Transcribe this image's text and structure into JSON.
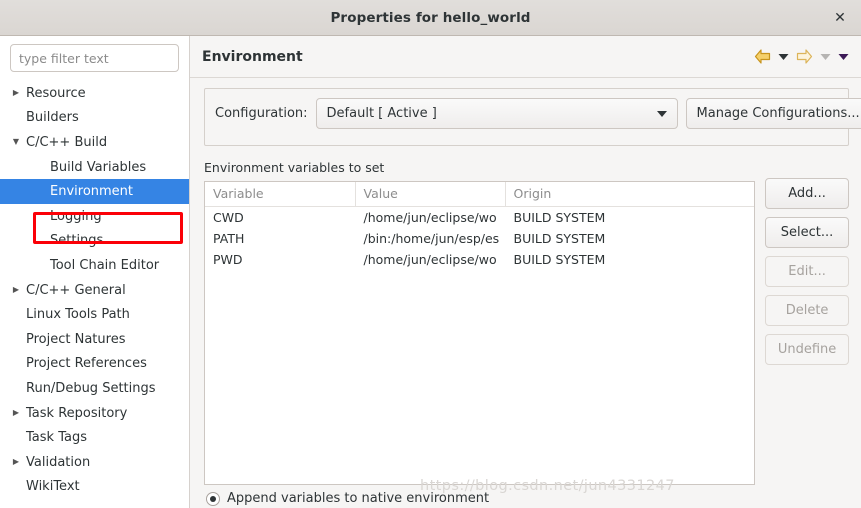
{
  "window": {
    "title": "Properties for hello_world",
    "close_label": "✕"
  },
  "sidebar": {
    "filter_placeholder": "type filter text",
    "filter_value": "",
    "items": [
      {
        "label": "Resource",
        "twisty": "collapsed",
        "indent": 0,
        "selected": false
      },
      {
        "label": "Builders",
        "twisty": "none",
        "indent": 0,
        "selected": false
      },
      {
        "label": "C/C++ Build",
        "twisty": "expanded",
        "indent": 0,
        "selected": false
      },
      {
        "label": "Build Variables",
        "twisty": "none",
        "indent": 1,
        "selected": false
      },
      {
        "label": "Environment",
        "twisty": "none",
        "indent": 1,
        "selected": true
      },
      {
        "label": "Logging",
        "twisty": "none",
        "indent": 1,
        "selected": false
      },
      {
        "label": "Settings",
        "twisty": "none",
        "indent": 1,
        "selected": false
      },
      {
        "label": "Tool Chain Editor",
        "twisty": "none",
        "indent": 1,
        "selected": false
      },
      {
        "label": "C/C++ General",
        "twisty": "collapsed",
        "indent": 0,
        "selected": false
      },
      {
        "label": "Linux Tools Path",
        "twisty": "none",
        "indent": 0,
        "selected": false
      },
      {
        "label": "Project Natures",
        "twisty": "none",
        "indent": 0,
        "selected": false
      },
      {
        "label": "Project References",
        "twisty": "none",
        "indent": 0,
        "selected": false
      },
      {
        "label": "Run/Debug Settings",
        "twisty": "none",
        "indent": 0,
        "selected": false
      },
      {
        "label": "Task Repository",
        "twisty": "collapsed",
        "indent": 0,
        "selected": false
      },
      {
        "label": "Task Tags",
        "twisty": "none",
        "indent": 0,
        "selected": false
      },
      {
        "label": "Validation",
        "twisty": "collapsed",
        "indent": 0,
        "selected": false
      },
      {
        "label": "WikiText",
        "twisty": "none",
        "indent": 0,
        "selected": false
      }
    ]
  },
  "page": {
    "title": "Environment",
    "nav_icons": [
      "back-arrow-icon",
      "back-dropdown-icon",
      "forward-arrow-icon",
      "forward-dropdown-icon",
      "menu-dropdown-icon"
    ]
  },
  "configuration": {
    "label": "Configuration:",
    "selected": "Default  [ Active ]",
    "manage_button": "Manage Configurations..."
  },
  "variables": {
    "caption": "Environment variables to set",
    "columns": [
      "Variable",
      "Value",
      "Origin"
    ],
    "rows": [
      {
        "variable": "CWD",
        "value": "/home/jun/eclipse/wo",
        "origin": "BUILD SYSTEM"
      },
      {
        "variable": "PATH",
        "value": "/bin:/home/jun/esp/es",
        "origin": "BUILD SYSTEM"
      },
      {
        "variable": "PWD",
        "value": "/home/jun/eclipse/wo",
        "origin": "BUILD SYSTEM"
      }
    ]
  },
  "side_buttons": [
    {
      "label": "Add...",
      "enabled": true
    },
    {
      "label": "Select...",
      "enabled": true
    },
    {
      "label": "Edit...",
      "enabled": false
    },
    {
      "label": "Delete",
      "enabled": false
    },
    {
      "label": "Undefine",
      "enabled": false
    }
  ],
  "bottom": {
    "radio_label": "Append variables to native environment",
    "radio_selected": true
  },
  "watermark": "https://blog.csdn.net/jun4331247",
  "colors": {
    "selection_blue": "#3584e4",
    "annotation_red": "#fb0007",
    "titlebar_bg": "#dad6d2",
    "pane_bg": "#f6f5f4"
  }
}
